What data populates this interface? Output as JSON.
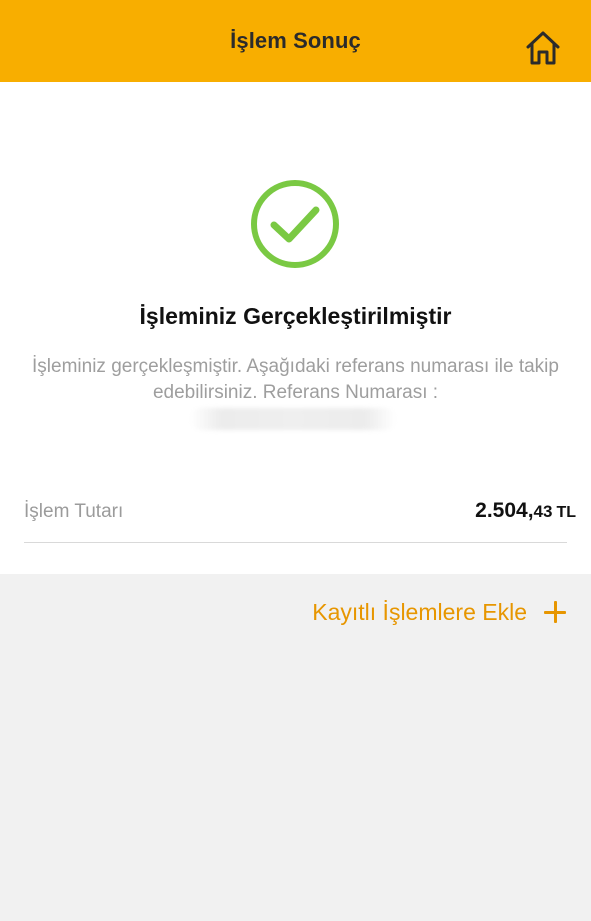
{
  "header": {
    "title": "İşlem Sonuç",
    "home_icon": "home-icon",
    "background_color": "#f8ae00"
  },
  "result": {
    "status_icon": "check-circle-icon",
    "success_color": "#7ac943",
    "title": "İşleminiz Gerçekleştirilmiştir",
    "description": "İşleminiz gerçekleşmiştir. Aşağıdaki referans numarası ile takip edebilirsiniz. Referans Numarası :"
  },
  "amount": {
    "label": "İşlem Tutarı",
    "integer_part": "2.504,",
    "decimal_part": "43",
    "currency": "TL"
  },
  "actions": {
    "add_to_saved_label": "Kayıtlı İşlemlere Ekle",
    "add_icon": "plus-icon",
    "accent_color": "#e79600"
  }
}
